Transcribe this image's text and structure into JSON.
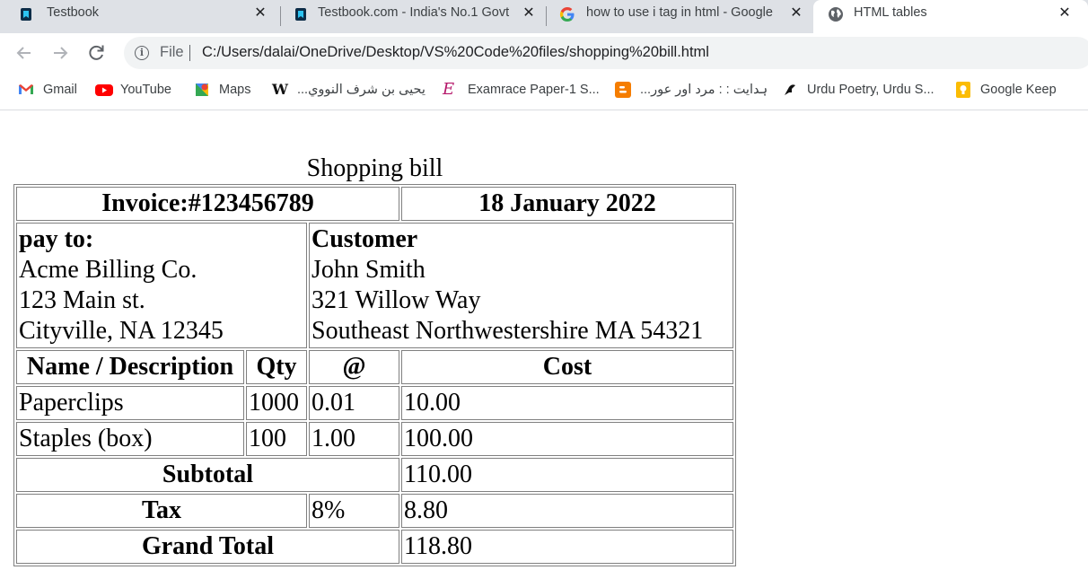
{
  "browser": {
    "tabs": [
      {
        "title": "Testbook",
        "icon": "testbook-icon",
        "active": false
      },
      {
        "title": "Testbook.com - India's No.1 Govt",
        "icon": "testbook-icon",
        "active": false
      },
      {
        "title": "how to use i tag in html - Google",
        "icon": "google-icon",
        "active": false
      },
      {
        "title": "HTML tables",
        "icon": "globe-icon",
        "active": true
      }
    ],
    "close_glyph": "✕",
    "address": {
      "scheme_label": "File",
      "url": "C:/Users/dalai/OneDrive/Desktop/VS%20Code%20files/shopping%20bill.html"
    },
    "bookmarks": [
      {
        "label": "Gmail",
        "icon": "gmail-icon"
      },
      {
        "label": "YouTube",
        "icon": "youtube-icon"
      },
      {
        "label": "Maps",
        "icon": "maps-icon"
      },
      {
        "label": "يحيى بن شرف النووي...",
        "icon": "wikipedia-icon"
      },
      {
        "label": "Examrace Paper-1 S...",
        "icon": "examrace-icon"
      },
      {
        "label": "ہدایت : : مرد اور عور...",
        "icon": "blogger-icon"
      },
      {
        "label": "Urdu Poetry, Urdu S...",
        "icon": "rekhta-icon"
      },
      {
        "label": "Google Keep",
        "icon": "keep-icon"
      }
    ],
    "colors": {
      "tabstrip": "#dee1e6",
      "omnibox": "#f1f3f4",
      "youtube": "#ff0000",
      "keep": "#fbbc04"
    }
  },
  "bill": {
    "caption": "Shopping bill",
    "invoice": "Invoice:#123456789",
    "date": "18 January 2022",
    "pay_to": {
      "heading": "pay to:",
      "lines": [
        "Acme Billing Co.",
        "123 Main st.",
        "Cityville, NA 12345"
      ]
    },
    "customer": {
      "heading": "Customer",
      "lines": [
        "John Smith",
        "321 Willow Way",
        "Southeast Northwestershire MA 54321"
      ]
    },
    "headers": {
      "name": "Name / Description",
      "qty": "Qty",
      "at": "@",
      "cost": "Cost"
    },
    "items": [
      {
        "name": "Paperclips",
        "qty": "1000",
        "at": "0.01",
        "cost": "10.00"
      },
      {
        "name": "Staples (box)",
        "qty": "100",
        "at": "1.00",
        "cost": "100.00"
      }
    ],
    "subtotal": {
      "label": "Subtotal",
      "value": "110.00"
    },
    "tax": {
      "label": "Tax",
      "rate": "8%",
      "value": "8.80"
    },
    "grand_total": {
      "label": "Grand Total",
      "value": "118.80"
    }
  }
}
